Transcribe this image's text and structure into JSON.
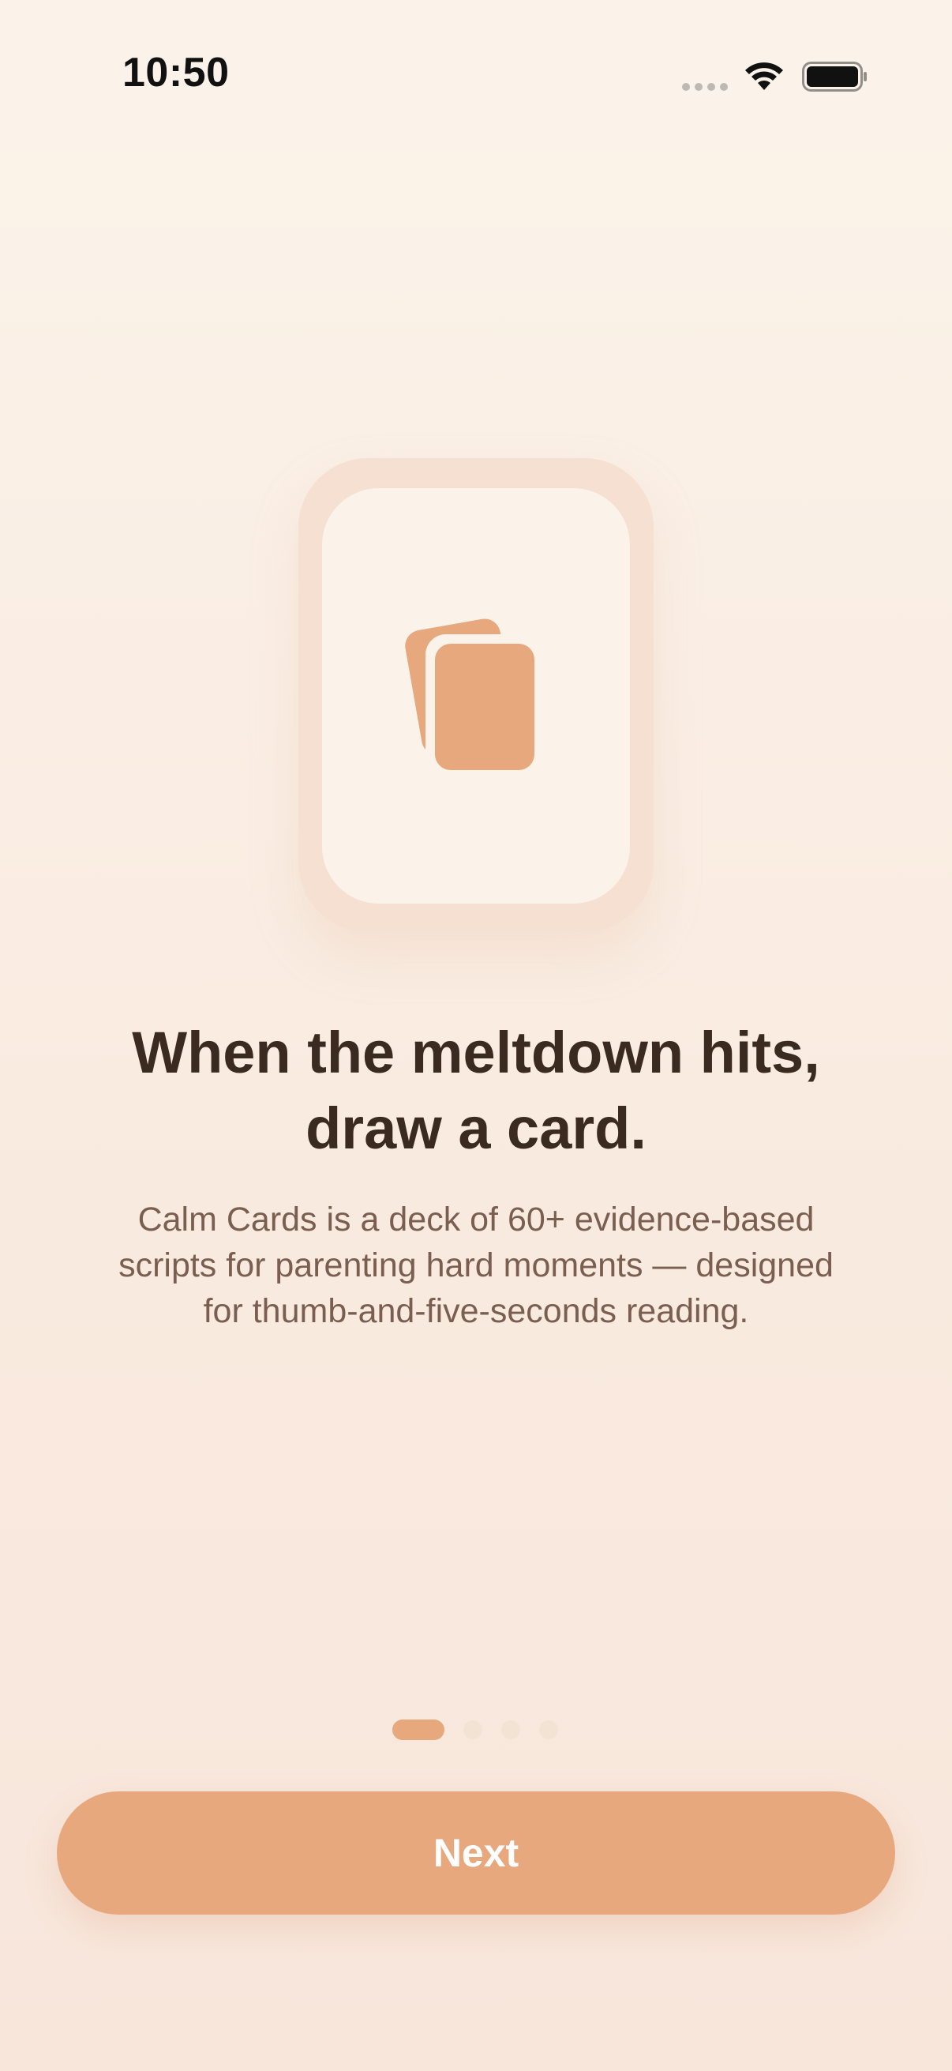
{
  "status_bar": {
    "time": "10:50",
    "icons": [
      "cellular-signal-icon",
      "wifi-icon",
      "battery-icon"
    ]
  },
  "hero": {
    "icon": "cards-stack-icon"
  },
  "onboarding": {
    "headline": "When the meltdown hits, draw a card.",
    "body": "Calm Cards is a deck of 60+ evidence-based scripts for parenting hard moments — designed for thumb-and-five-seconds reading."
  },
  "pager": {
    "current_page": 1,
    "total_pages": 4
  },
  "actions": {
    "next_label": "Next"
  },
  "colors": {
    "accent": "#E8A87E",
    "background": "#FBF3EA",
    "headline": "#3A2A20",
    "body": "#7A5E50",
    "card_frame": "#F6E0D1"
  }
}
